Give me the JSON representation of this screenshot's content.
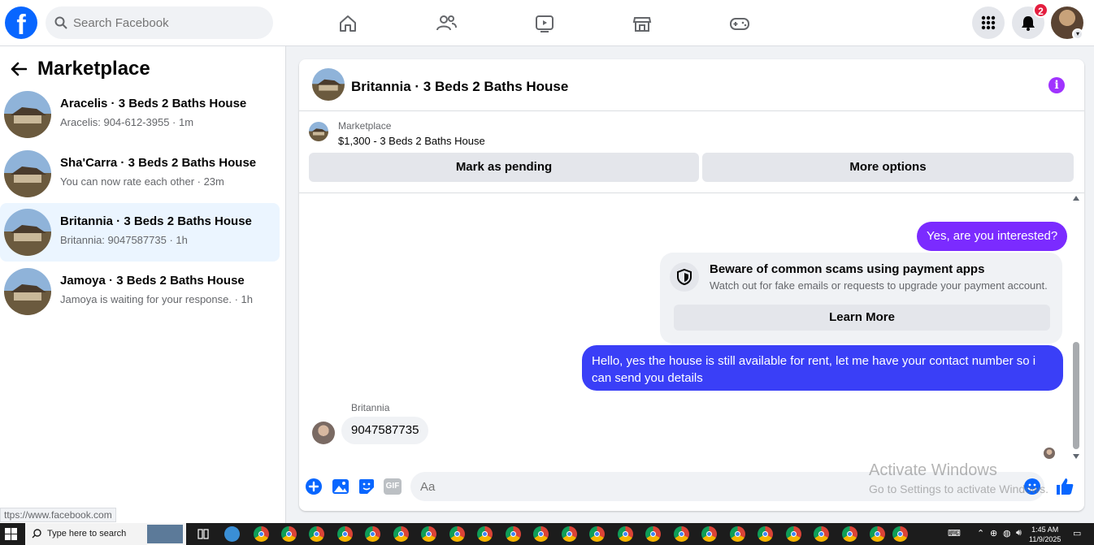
{
  "top_nav": {
    "search_placeholder": "Search Facebook",
    "notification_count": "2"
  },
  "sidebar": {
    "title": "Marketplace",
    "conversations": [
      {
        "name": "Aracelis · 3 Beds 2 Baths House",
        "preview": "Aracelis: 904-612-3955 · 1m"
      },
      {
        "name": "Sha'Carra · 3 Beds 2 Baths House",
        "preview": "You can now rate each other · 23m"
      },
      {
        "name": "Britannia · 3 Beds 2 Baths House",
        "preview": "Britannia: 9047587735 · 1h"
      },
      {
        "name": "Jamoya · 3 Beds 2 Baths House",
        "preview": "Jamoya is waiting for your response. · 1h"
      }
    ],
    "status_url": "ttps://www.facebook.com"
  },
  "chat": {
    "title": "Britannia · 3 Beds 2 Baths House",
    "listing": {
      "category": "Marketplace",
      "price_title": "$1,300 - 3 Beds 2 Baths House"
    },
    "buttons": {
      "mark_pending": "Mark as pending",
      "more_options": "More options"
    },
    "messages": {
      "outgoing_1": "Yes, are you interested?",
      "scam_title": "Beware of common scams using payment apps",
      "scam_body": "Watch out for fake emails or requests to upgrade your payment account.",
      "learn_more": "Learn More",
      "outgoing_2": "Hello, yes the house is still available for rent, let me have your contact number so i can send you  details",
      "sender_name": "Britannia",
      "incoming_1": "9047587735"
    },
    "composer_placeholder": "Aa",
    "composer_gif": "GIF"
  },
  "watermark": {
    "line1": "Activate Windows",
    "line2": "Go to Settings to activate Windows."
  },
  "taskbar": {
    "search_text": "Type here to search",
    "time": "1:45 AM",
    "date": "11/9/2025"
  },
  "colors": {
    "brand_blue": "#0866ff",
    "outgoing_bubble": "#7b2bff",
    "badge_red": "#e41e3f",
    "active_conversation": "#ebf5ff"
  }
}
